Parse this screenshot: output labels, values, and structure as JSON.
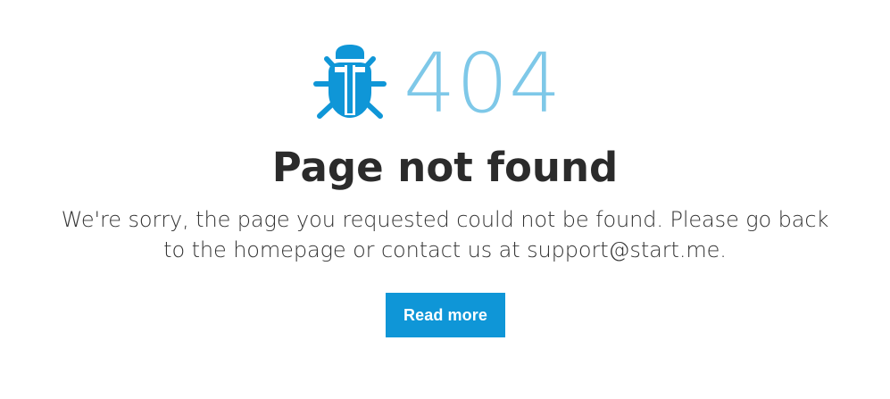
{
  "error_page": {
    "icon": "bug-icon",
    "code": "404",
    "title": "Page not found",
    "message_lines": [
      "We're sorry, the page you requested could not be found. Please go back",
      "to the homepage or contact us at support@start.me."
    ],
    "button_label": "Read more"
  },
  "colors": {
    "accent": "#0F96D7",
    "error_code": "#7EC8E8",
    "title": "#2B2B2B",
    "body_text": "#333333",
    "background": "#FFFFFF"
  }
}
